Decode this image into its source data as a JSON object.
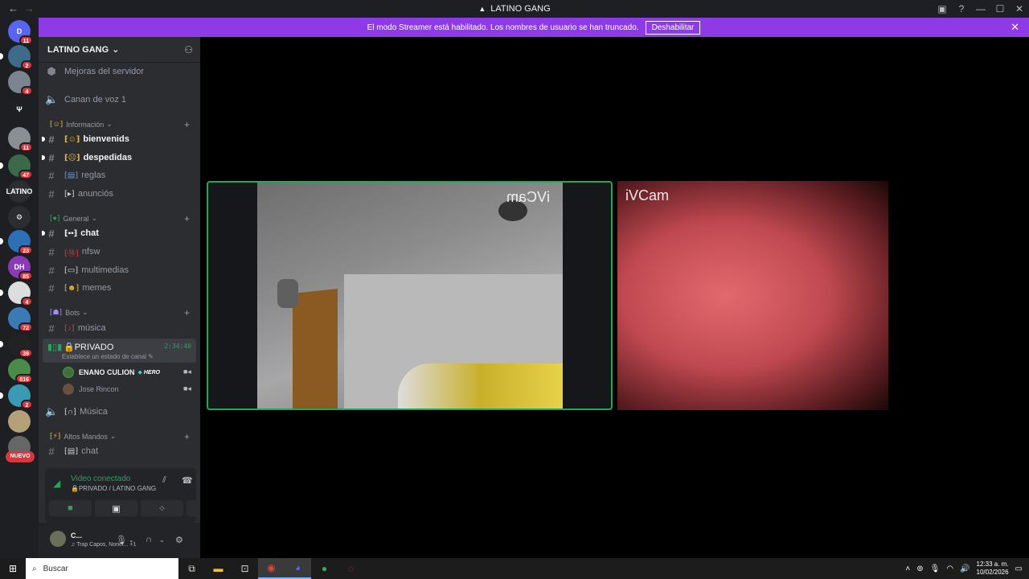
{
  "window": {
    "title": "LATINO GANG",
    "controls": [
      "▣",
      "?",
      "—",
      "☐",
      "✕"
    ]
  },
  "streamer_banner": {
    "text": "El modo Streamer está habilitado. Los nombres de usuario se han truncado.",
    "button": "Deshabilitar"
  },
  "rail": {
    "servers": [
      {
        "label": "D",
        "badge": "11",
        "color": "#5865f2"
      },
      {
        "label": "",
        "badge": "2",
        "color": "#3f6b8a"
      },
      {
        "label": "",
        "badge": "4",
        "color": "#7a8590"
      },
      {
        "label": "Ψ",
        "badge": "",
        "color": "#1e1f22"
      },
      {
        "label": "",
        "badge": "11",
        "color": "#8a8f95"
      },
      {
        "label": "",
        "badge": "47",
        "color": "#3a6a4a"
      },
      {
        "label": "LATINO",
        "badge": "",
        "color": "#2b2d31"
      },
      {
        "label": "⚙",
        "badge": "",
        "color": "#2b2d31"
      },
      {
        "label": "",
        "badge": "23",
        "color": "#2d6fb5"
      },
      {
        "label": "DH",
        "badge": "85",
        "color": "#8a3ab5"
      },
      {
        "label": "",
        "badge": "4",
        "color": "#ddd"
      },
      {
        "label": "",
        "badge": "72",
        "color": "#3a7ab5"
      },
      {
        "label": "",
        "badge": "39",
        "color": "#222"
      },
      {
        "label": "",
        "badge": "816",
        "color": "#4a8a4a"
      },
      {
        "label": "",
        "badge": "2",
        "color": "#3a9ab5"
      },
      {
        "label": "",
        "badge": "",
        "color": "#b5a07a"
      },
      {
        "label": "",
        "badge": "",
        "color": "#666"
      }
    ],
    "new_label": "NUEVO"
  },
  "sidebar": {
    "guild_name": "LATINO GANG",
    "boost": "Mejoras del servidor",
    "voice1": "Canan de voz 1",
    "categories": {
      "info": "Información",
      "general": "General",
      "bots": "Bots",
      "altos": "Altos Mandos"
    },
    "channels": {
      "bienvenids": "bienvenids",
      "despedidas": "despedidas",
      "reglas": "reglas",
      "anuncios": "anunciós",
      "chat": "chat",
      "nfsw": "nfsw",
      "multimedias": "multimedias",
      "memes": "memes",
      "musica": "música",
      "musica2": "Música",
      "chat2": "chat"
    },
    "voice_channel": {
      "name": "PRIVADO",
      "timer": "2:34:40",
      "status": "Establece un estado de canal"
    },
    "members": [
      {
        "name": "ENANO CULION",
        "tag": "HERO",
        "color": "#f2f3f5"
      },
      {
        "name": "Jose Rincon",
        "tag": "",
        "color": "#949ba4"
      }
    ]
  },
  "voice_panel": {
    "status": "Video conectado",
    "location": "PRIVADO / LATINO GANG"
  },
  "user": {
    "name": "C...",
    "activity": "Trap Capos, Noriel...",
    "extra": "+1"
  },
  "stage": {
    "tile1_watermark": "iVCam",
    "tile2_watermark": "iVCam"
  },
  "taskbar": {
    "search": "Buscar",
    "time": "12:33 a. m.",
    "date": "10/02/2026"
  }
}
